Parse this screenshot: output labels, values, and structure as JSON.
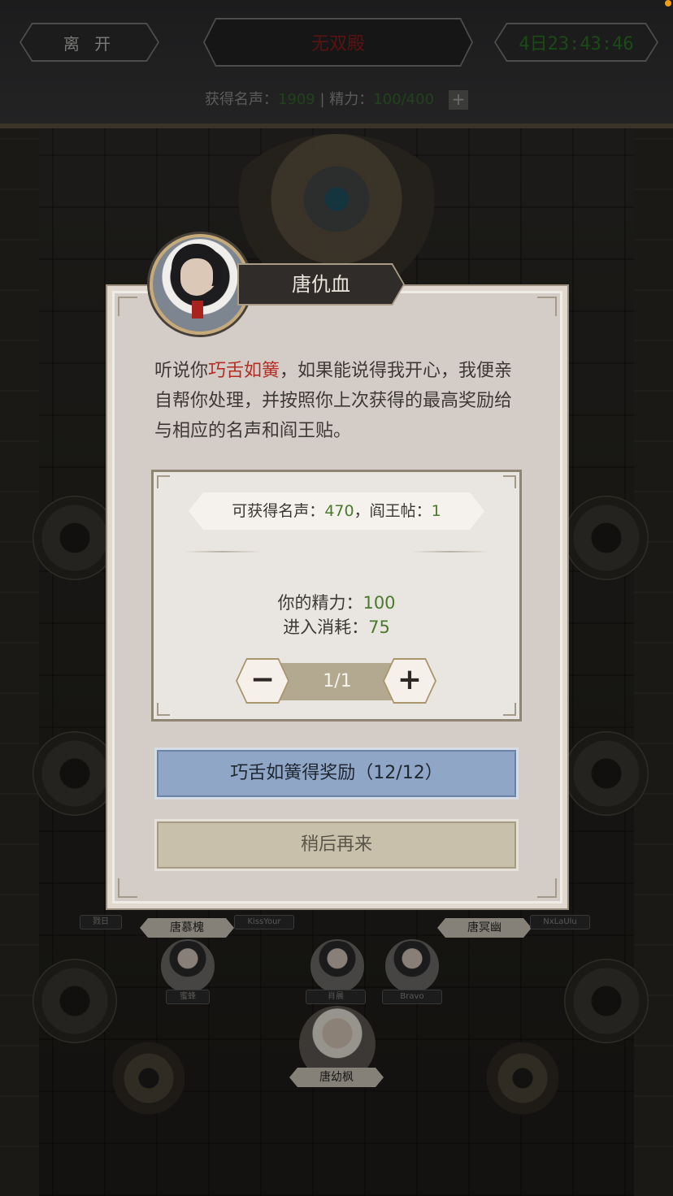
{
  "header": {
    "leave_label": "离 开",
    "title": "无双殿",
    "timer": "4日23:43:46",
    "fame_label": "获得名声：",
    "fame_value": "1909",
    "separator": " | ",
    "energy_label": "精力：",
    "energy_value": "100/400",
    "plus_label": "+"
  },
  "board": {
    "players": [
      {
        "name": "唐慕槐"
      },
      {
        "name": "唐冥幽"
      },
      {
        "name": "唐幼枫"
      },
      {
        "name": "蜜蜂"
      },
      {
        "name": "肖晨"
      },
      {
        "name": "Bravo"
      },
      {
        "name": "KissYour"
      },
      {
        "name": "NxLaUlu"
      },
      {
        "name": "戮日"
      }
    ]
  },
  "dialog": {
    "npc_name": "唐仇血",
    "text_before": "听说你",
    "text_highlight": "巧舌如簧",
    "text_after": "，如果能说得我开心，我便亲自帮你处理，并按照你上次获得的最高奖励给与相应的名声和阎王贴。",
    "reward_prefix": "可获得名声：",
    "reward_fame": "470",
    "reward_mid": "，阎王帖：",
    "reward_tickets": "1",
    "energy_label": "你的精力：",
    "energy_value": "100",
    "cost_label": "进入消耗：",
    "cost_value": "75",
    "stepper_value": "1/1",
    "minus_symbol": "−",
    "plus_symbol": "+",
    "primary_button": "巧舌如簧得奖励（12/12）",
    "secondary_button": "稍后再来"
  },
  "colors": {
    "highlight_red": "#b32d24",
    "value_green": "#4a7a2d",
    "primary_blue": "#8fa6c6"
  }
}
